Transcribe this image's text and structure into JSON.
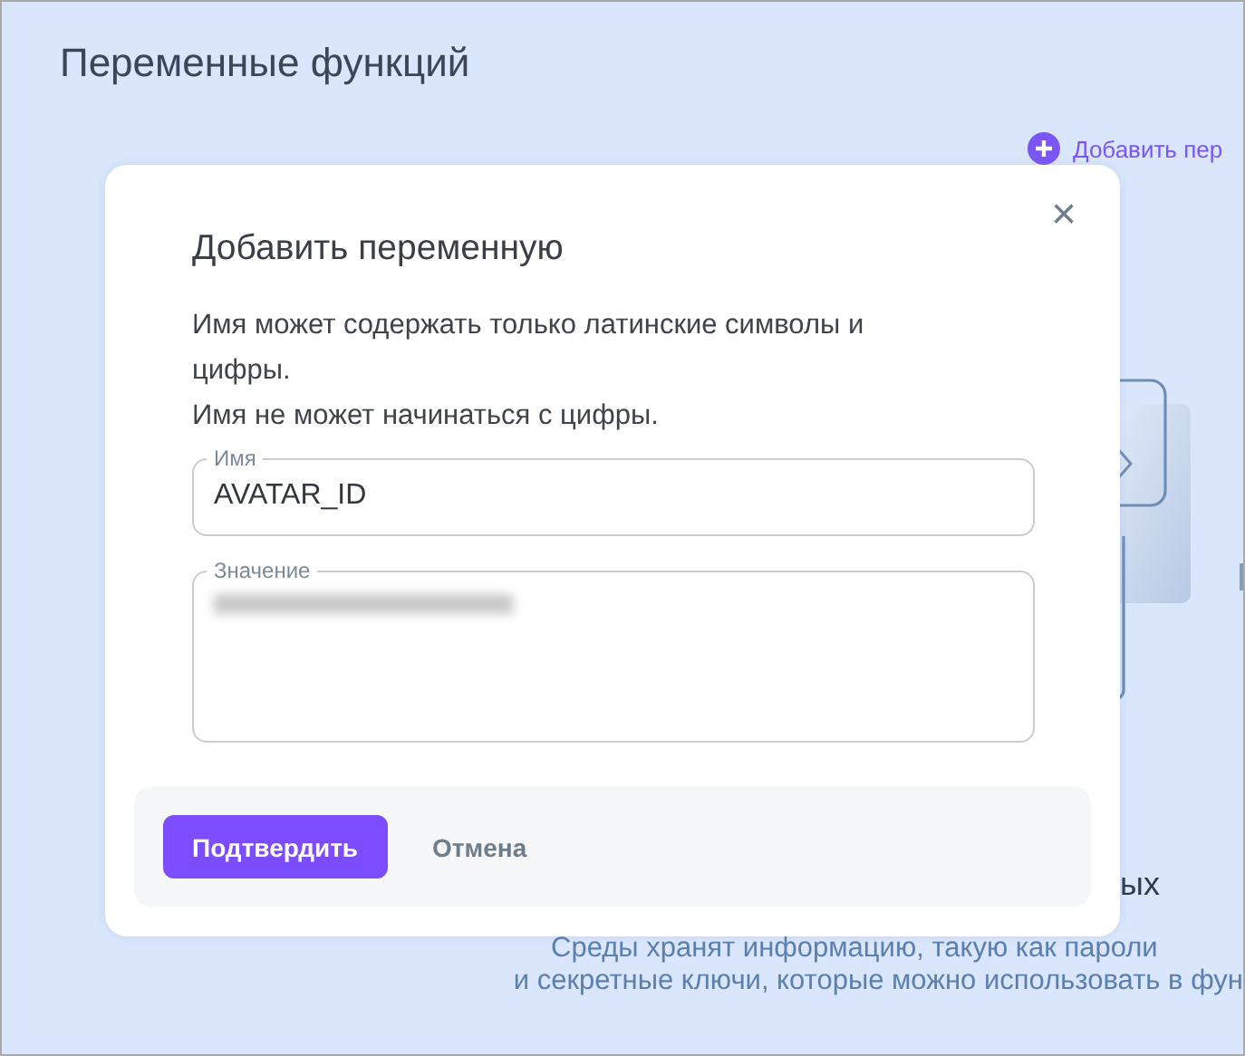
{
  "page": {
    "title": "Переменные функций",
    "add_link": "Добавить пер",
    "empty_heading": "ых",
    "empty_text": [
      "Среды хранят информацию, такую как пароли",
      "и секретные ключи, которые можно использовать в фун"
    ]
  },
  "dialog": {
    "title": "Добавить переменную",
    "close": "×",
    "hints": [
      "Имя может содержать только латинские символы и цифры.",
      "Имя не может начинаться с цифры."
    ],
    "fields": [
      {
        "label": "Имя",
        "value": "AVATAR_ID",
        "kind": "line",
        "hidden": false
      },
      {
        "label": "Значение",
        "kind": "area",
        "hidden": true
      }
    ],
    "buttons": [
      {
        "label": "Подтвердить",
        "kind": "primary"
      },
      {
        "label": "Отмена",
        "kind": "text"
      }
    ]
  }
}
